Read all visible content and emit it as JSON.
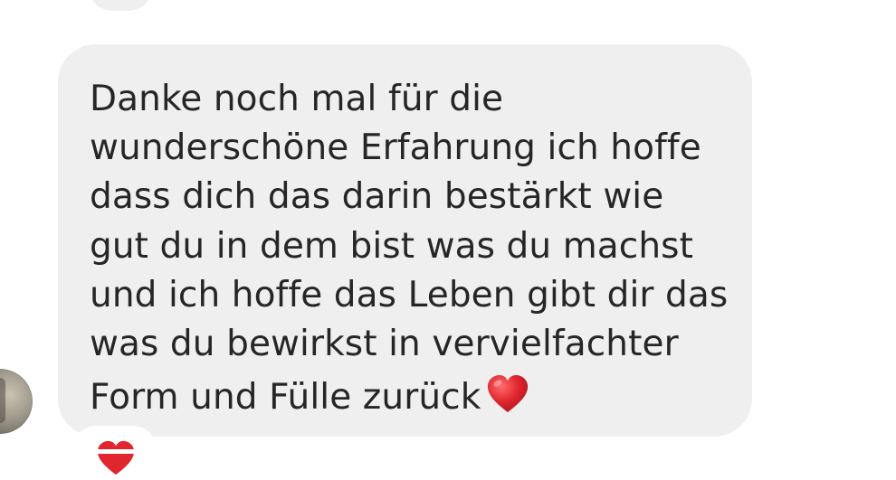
{
  "message": {
    "lines": [
      "Danke noch mal für die",
      "wunderschöne Erfahrung ich hoffe",
      "dass dich das darin bestärkt wie",
      "gut du in dem bist was du machst",
      "und ich hoffe das Leben gibt dir das",
      "was du bewirkst in vervielfachter",
      "Form und Fülle zurück"
    ],
    "emoji": "red-heart-icon"
  },
  "reaction": {
    "emoji": "red-heart-icon"
  },
  "colors": {
    "bubble": "#efefef",
    "text": "#262626",
    "heart": "#e0262e",
    "background": "#ffffff"
  }
}
